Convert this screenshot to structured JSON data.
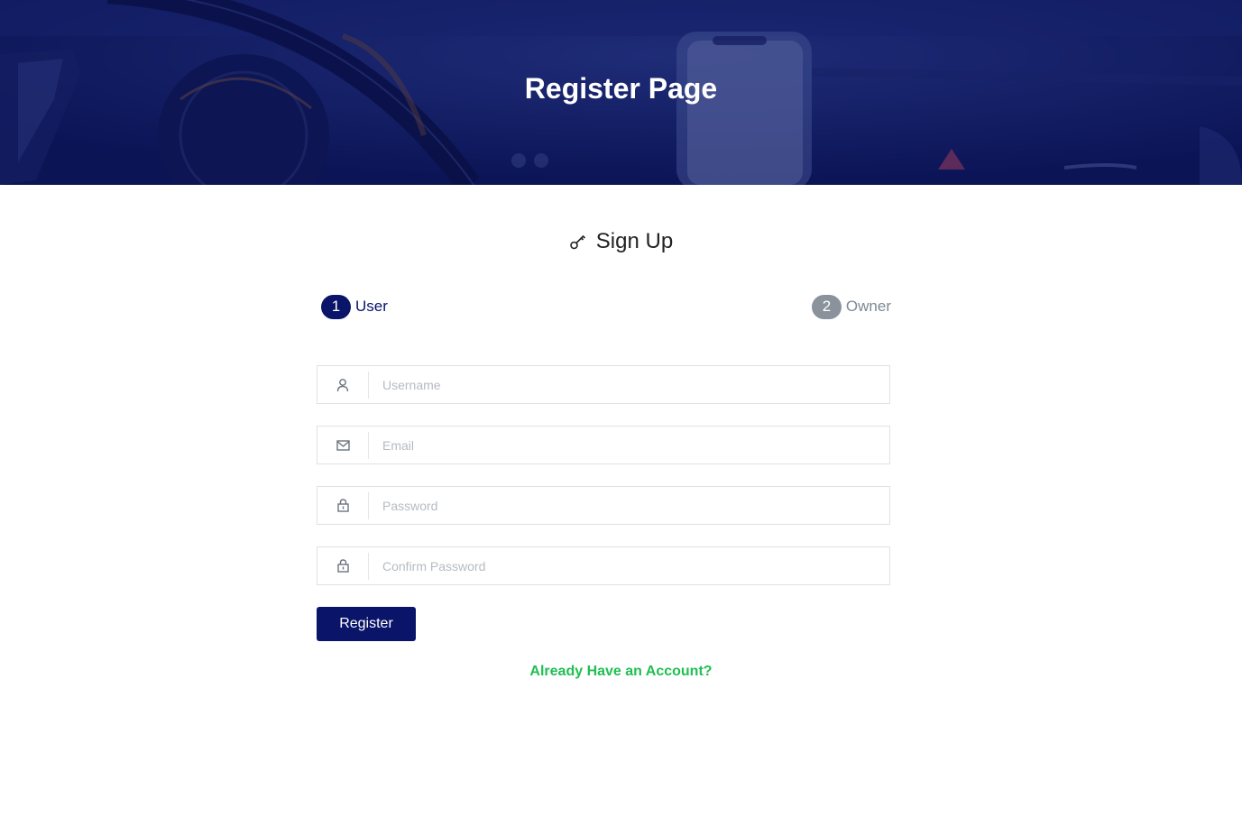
{
  "hero": {
    "title": "Register Page"
  },
  "form": {
    "heading": "Sign Up",
    "heading_icon": "key-icon",
    "steps": [
      {
        "number": "1",
        "label": "User",
        "active": true
      },
      {
        "number": "2",
        "label": "Owner",
        "active": false
      }
    ],
    "fields": {
      "username": {
        "placeholder": "Username",
        "value": "",
        "icon": "user-icon"
      },
      "email": {
        "placeholder": "Email",
        "value": "",
        "icon": "mail-icon"
      },
      "password": {
        "placeholder": "Password",
        "value": "",
        "icon": "lock-icon"
      },
      "confirm_password": {
        "placeholder": "Confirm Password",
        "value": "",
        "icon": "lock-icon"
      }
    },
    "register_label": "Register",
    "login_link": "Already Have an Account?"
  },
  "colors": {
    "primary": "#0a1469",
    "inactive_step": "#8a929c",
    "link": "#1fbf52",
    "hero_overlay": "#0c1456"
  }
}
